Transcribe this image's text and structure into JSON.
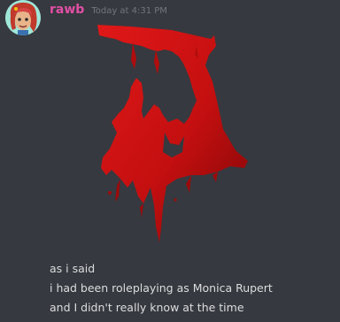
{
  "message": {
    "author": "rawb",
    "timestamp": "Today at 4:31 PM",
    "author_color": "#e14fa5",
    "attachment_icon": "bloody-logo-image",
    "lines": [
      "as i said",
      "i had been roleplaying as Monica Rupert",
      "and I didn't really know at the time"
    ]
  }
}
